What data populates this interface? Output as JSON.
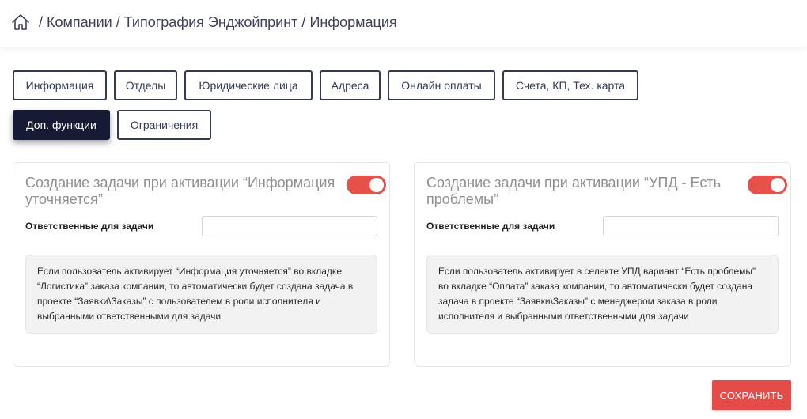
{
  "breadcrumb": {
    "home_icon": "home-icon",
    "items": [
      "Компании",
      "Типография Энджойпринт",
      "Информация"
    ]
  },
  "tabs": [
    {
      "label": "Информация",
      "active": false
    },
    {
      "label": "Отделы",
      "active": false
    },
    {
      "label": "Юридические лица",
      "active": false
    },
    {
      "label": "Адреса",
      "active": false
    },
    {
      "label": "Онлайн оплаты",
      "active": false
    },
    {
      "label": "Счета, КП, Тех. карта",
      "active": false
    },
    {
      "label": "Доп. функции",
      "active": true
    },
    {
      "label": "Ограничения",
      "active": false
    }
  ],
  "cards": [
    {
      "title": "Создание задачи при активации “Информация уточняется”",
      "toggle_on": true,
      "field_label": "Ответственные для задачи",
      "field_value": "",
      "note": "Если пользователь активирует “Информация уточняется” во вкладке “Логистика” заказа компании, то автоматически будет создана задача в проекте “Заявки\\Заказы” с пользователем в роли исполнителя и выбранными ответственными для задачи"
    },
    {
      "title": "Создание задачи при активации “УПД - Есть проблемы”",
      "toggle_on": true,
      "field_label": "Ответственные для задачи",
      "field_value": "",
      "note": "Если пользователь активирует в селекте УПД вариант “Есть проблемы” во вкладке “Оплата” заказа компании, то автоматически будет создана задача в проекте “Заявки\\Заказы” с менеджером заказа в роли исполнителя и выбранными ответственными для задачи"
    }
  ],
  "save_button": "СОХРАНИТЬ",
  "colors": {
    "accent_red": "#e54b47",
    "tab_border": "#343a55",
    "tab_active_bg": "#161a33"
  }
}
